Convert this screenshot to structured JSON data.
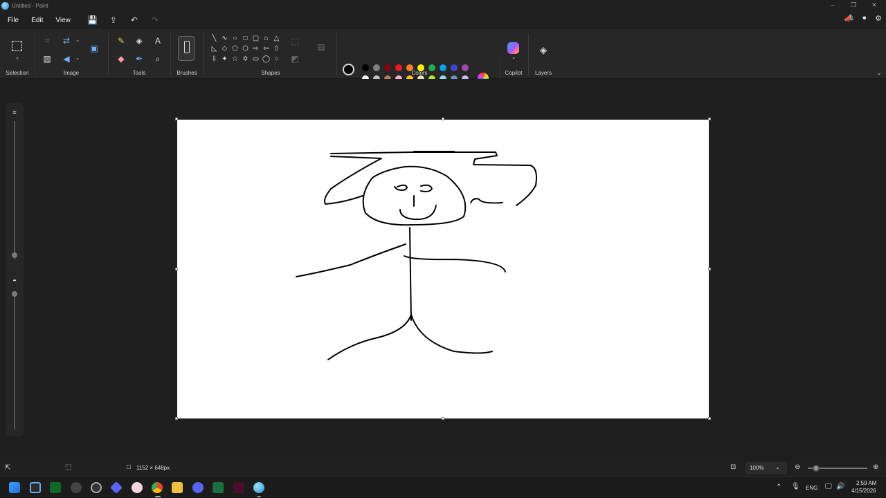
{
  "window": {
    "title": "Untitled - Paint"
  },
  "menu": {
    "file": "File",
    "edit": "Edit",
    "view": "View"
  },
  "ribbon": {
    "selection": "Selection",
    "image": "Image",
    "tools": "Tools",
    "brushes": "Brushes",
    "shapes": "Shapes",
    "colors": "Colors",
    "copilot": "Copilot",
    "layers": "Layers"
  },
  "palette": {
    "primary": "#000000",
    "secondary": "#ffffff",
    "row1": [
      "#000000",
      "#7f7f7f",
      "#880015",
      "#ed1c24",
      "#ff7f27",
      "#fff200",
      "#22b14c",
      "#00a2e8",
      "#3f48cc",
      "#a349a4"
    ],
    "row2": [
      "#ffffff",
      "#c3c3c3",
      "#b97a57",
      "#ffaec9",
      "#ffc90e",
      "#efe4b0",
      "#b5e61d",
      "#99d9ea",
      "#7092be",
      "#c8bfe7"
    ]
  },
  "status": {
    "canvas_size": "1152 × 648px",
    "zoom": "100%"
  },
  "tray": {
    "language": "ENG",
    "time": "2:59 AM",
    "date": "4/15/2026"
  }
}
